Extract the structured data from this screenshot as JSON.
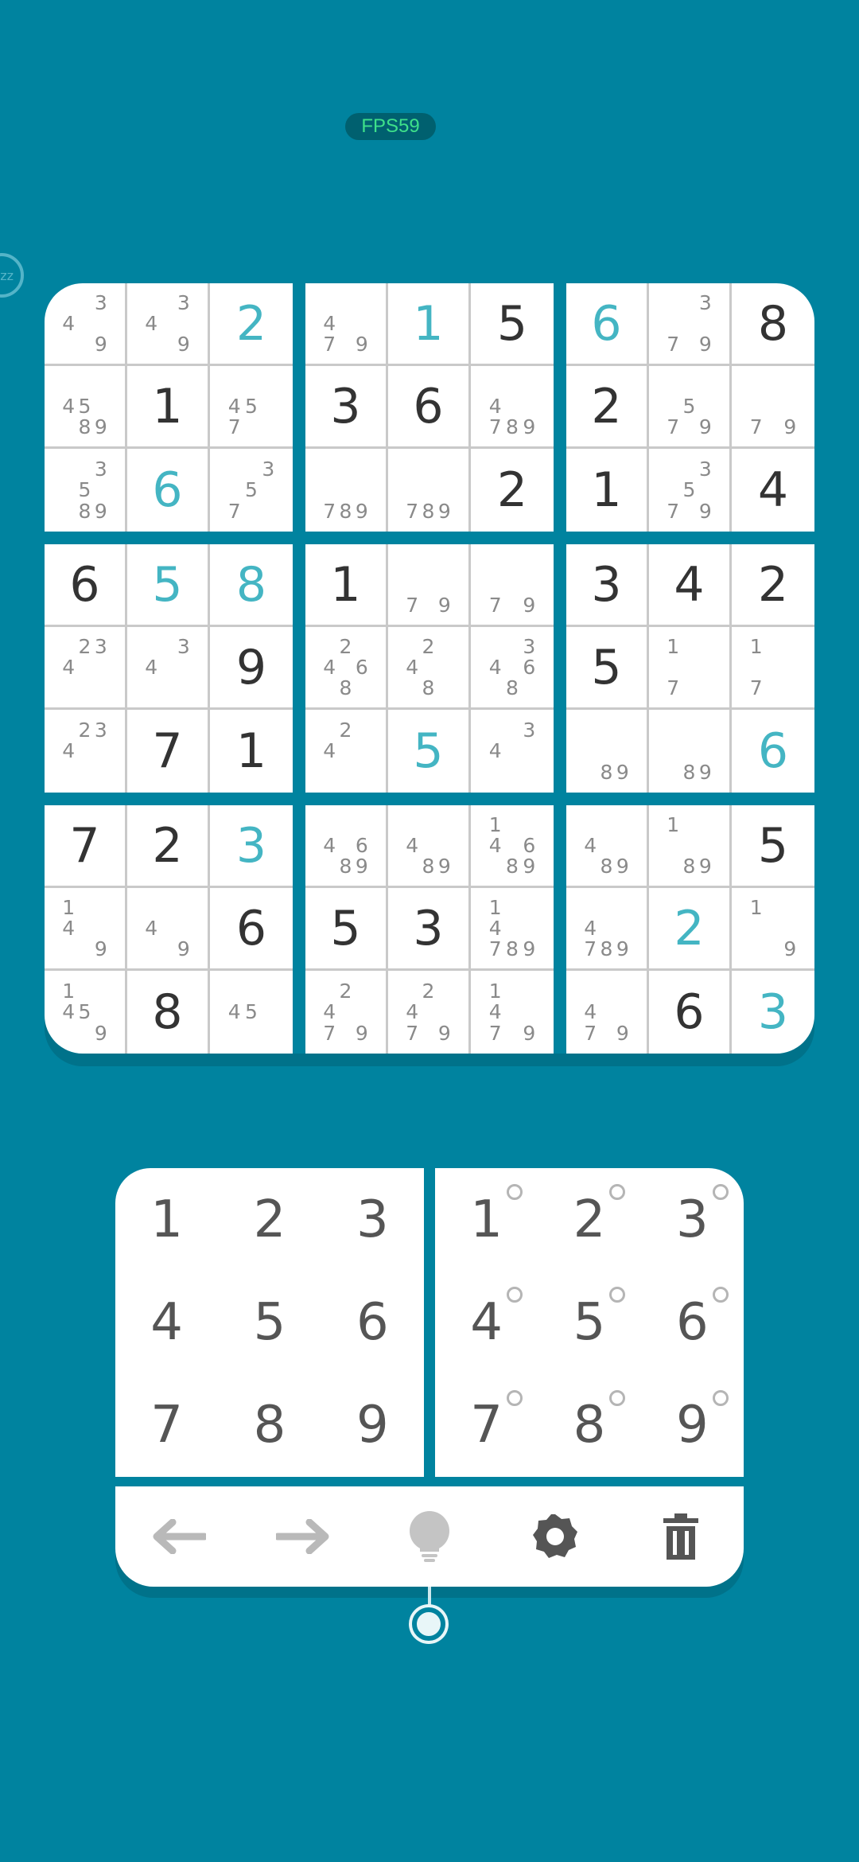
{
  "fps_label": "FPS59",
  "sleep_label": "zz",
  "board": [
    [
      {
        "v": "",
        "n": "",
        "w": [
          3,
          4,
          9
        ]
      },
      {
        "v": "",
        "n": "",
        "w": [
          3,
          4,
          9
        ]
      },
      {
        "v": "2",
        "t": "user"
      },
      {
        "v": "",
        "w": [
          4,
          7,
          9
        ]
      },
      {
        "v": "1",
        "t": "user"
      },
      {
        "v": "5",
        "t": "given"
      },
      {
        "v": "6",
        "t": "user"
      },
      {
        "v": "",
        "w": [
          3,
          7,
          9
        ]
      },
      {
        "v": "8",
        "t": "given"
      }
    ],
    [
      {
        "v": "",
        "w": [
          4,
          5,
          8,
          9
        ]
      },
      {
        "v": "1",
        "t": "given"
      },
      {
        "v": "",
        "w": [
          4,
          5,
          7
        ]
      },
      {
        "v": "3",
        "t": "given"
      },
      {
        "v": "6",
        "t": "given"
      },
      {
        "v": "",
        "w": [
          4,
          7,
          8,
          9
        ]
      },
      {
        "v": "2",
        "t": "given"
      },
      {
        "v": "",
        "w": [
          5,
          7,
          9
        ]
      },
      {
        "v": "",
        "w": [
          7,
          9
        ]
      }
    ],
    [
      {
        "v": "",
        "w": [
          3,
          5,
          8,
          9
        ]
      },
      {
        "v": "6",
        "t": "user"
      },
      {
        "v": "",
        "w": [
          3,
          5,
          7
        ]
      },
      {
        "v": "",
        "w": [
          7,
          8,
          9
        ]
      },
      {
        "v": "",
        "w": [
          7,
          8,
          9
        ]
      },
      {
        "v": "2",
        "t": "given"
      },
      {
        "v": "1",
        "t": "given"
      },
      {
        "v": "",
        "w": [
          3,
          5,
          7,
          9
        ]
      },
      {
        "v": "4",
        "t": "given"
      }
    ],
    [
      {
        "v": "6",
        "t": "given"
      },
      {
        "v": "5",
        "t": "user"
      },
      {
        "v": "8",
        "t": "user"
      },
      {
        "v": "1",
        "t": "given"
      },
      {
        "v": "",
        "w": [
          7,
          9
        ]
      },
      {
        "v": "",
        "w": [
          7,
          9
        ]
      },
      {
        "v": "3",
        "t": "given"
      },
      {
        "v": "4",
        "t": "given"
      },
      {
        "v": "2",
        "t": "given"
      }
    ],
    [
      {
        "v": "",
        "w": [
          2,
          3,
          4
        ]
      },
      {
        "v": "",
        "w": [
          3,
          4
        ]
      },
      {
        "v": "9",
        "t": "given"
      },
      {
        "v": "",
        "w": [
          2,
          4,
          6,
          8
        ]
      },
      {
        "v": "",
        "w": [
          2,
          4,
          8
        ]
      },
      {
        "v": "",
        "w": [
          3,
          4,
          6,
          8
        ]
      },
      {
        "v": "5",
        "t": "given"
      },
      {
        "v": "",
        "w": [
          1,
          7
        ]
      },
      {
        "v": "",
        "w": [
          1,
          7
        ]
      }
    ],
    [
      {
        "v": "",
        "w": [
          2,
          3,
          4
        ]
      },
      {
        "v": "7",
        "t": "given"
      },
      {
        "v": "1",
        "t": "given"
      },
      {
        "v": "",
        "w": [
          2,
          4
        ]
      },
      {
        "v": "5",
        "t": "user"
      },
      {
        "v": "",
        "w": [
          3,
          4
        ]
      },
      {
        "v": "",
        "w": [
          8,
          9
        ]
      },
      {
        "v": "",
        "w": [
          8,
          9
        ]
      },
      {
        "v": "6",
        "t": "user"
      }
    ],
    [
      {
        "v": "7",
        "t": "given"
      },
      {
        "v": "2",
        "t": "given"
      },
      {
        "v": "3",
        "t": "user"
      },
      {
        "v": "",
        "w": [
          4,
          6,
          8,
          9
        ]
      },
      {
        "v": "",
        "w": [
          4,
          8,
          9
        ]
      },
      {
        "v": "",
        "w": [
          1,
          4,
          6,
          8,
          9
        ]
      },
      {
        "v": "",
        "w": [
          4,
          8,
          9
        ]
      },
      {
        "v": "",
        "w": [
          1,
          8,
          9
        ]
      },
      {
        "v": "5",
        "t": "given"
      }
    ],
    [
      {
        "v": "",
        "w": [
          1,
          4,
          9
        ]
      },
      {
        "v": "",
        "w": [
          4,
          9
        ]
      },
      {
        "v": "6",
        "t": "given"
      },
      {
        "v": "5",
        "t": "given"
      },
      {
        "v": "3",
        "t": "given"
      },
      {
        "v": "",
        "w": [
          1,
          4,
          7,
          8,
          9
        ]
      },
      {
        "v": "",
        "w": [
          4,
          7,
          8,
          9
        ]
      },
      {
        "v": "2",
        "t": "user"
      },
      {
        "v": "",
        "w": [
          1,
          9
        ]
      }
    ],
    [
      {
        "v": "",
        "w": [
          1,
          4,
          5,
          9
        ]
      },
      {
        "v": "8",
        "t": "given"
      },
      {
        "v": "",
        "w": [
          4,
          5
        ]
      },
      {
        "v": "",
        "w": [
          2,
          4,
          7,
          9
        ]
      },
      {
        "v": "",
        "w": [
          2,
          4,
          7,
          9
        ]
      },
      {
        "v": "",
        "w": [
          1,
          4,
          7,
          9
        ]
      },
      {
        "v": "",
        "w": [
          4,
          7,
          9
        ]
      },
      {
        "v": "6",
        "t": "given"
      },
      {
        "v": "3",
        "t": "user"
      }
    ]
  ],
  "number_pad": [
    "1",
    "2",
    "3",
    "4",
    "5",
    "6",
    "7",
    "8",
    "9"
  ],
  "note_pad": [
    "1",
    "2",
    "3",
    "4",
    "5",
    "6",
    "7",
    "8",
    "9"
  ],
  "toolbar": {
    "icons": [
      "undo-arrow-icon",
      "redo-arrow-icon",
      "hint-bulb-icon",
      "settings-gear-icon",
      "trash-icon"
    ]
  },
  "colors": {
    "background": "#00839f",
    "user_digit": "#44b5c3",
    "given_digit": "#333333",
    "note_digit": "#8a8a8a"
  }
}
